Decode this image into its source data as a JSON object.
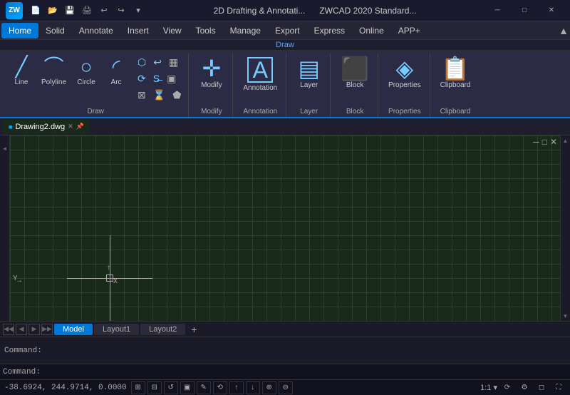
{
  "titlebar": {
    "app_name": "ZW",
    "workspace": "2D Drafting & Annotati...",
    "standard": "ZWCAD 2020 Standard...",
    "minimize": "─",
    "maximize": "□",
    "close": "✕"
  },
  "menubar": {
    "items": [
      "Home",
      "Solid",
      "Annotate",
      "Insert",
      "View",
      "Tools",
      "Manage",
      "Export",
      "Express",
      "Online",
      "APP+"
    ]
  },
  "ribbon": {
    "groups": [
      {
        "label": "Draw",
        "items": [
          {
            "icon": "╱",
            "label": "Line"
          },
          {
            "icon": "⌒",
            "label": "Polyline"
          },
          {
            "icon": "○",
            "label": "Circle"
          },
          {
            "icon": "◜",
            "label": "Arc"
          }
        ]
      },
      {
        "label": "",
        "items": []
      },
      {
        "label": "",
        "items": [
          {
            "icon": "✛",
            "label": "Modify"
          }
        ]
      },
      {
        "label": "",
        "items": [
          {
            "icon": "A",
            "label": "Annotation"
          }
        ]
      },
      {
        "label": "",
        "items": [
          {
            "icon": "▤",
            "label": "Layer"
          }
        ]
      },
      {
        "label": "",
        "items": [
          {
            "icon": "⬛",
            "label": "Block"
          }
        ]
      },
      {
        "label": "",
        "items": [
          {
            "icon": "◈",
            "label": "Properties"
          }
        ]
      },
      {
        "label": "",
        "items": [
          {
            "icon": "📋",
            "label": "Clipboard"
          }
        ]
      }
    ],
    "draw_label": "Draw"
  },
  "file_tabs": {
    "tabs": [
      {
        "icon": "■",
        "name": "Drawing2.dwg",
        "active": true,
        "closeable": true
      }
    ]
  },
  "layout_tabs": {
    "tabs": [
      "Model",
      "Layout1",
      "Layout2"
    ],
    "active": "Model",
    "add_label": "+"
  },
  "command": {
    "output": "Command:",
    "prompt": "Command:",
    "placeholder": ""
  },
  "statusbar": {
    "coords": "-38.6924, 244.9714, 0.0000",
    "scale": "1:1",
    "icons": [
      "⊞",
      "⊟",
      "↺",
      "▣",
      "✎",
      "⟲",
      "↑",
      "↓",
      "⊕",
      "⊖"
    ]
  }
}
